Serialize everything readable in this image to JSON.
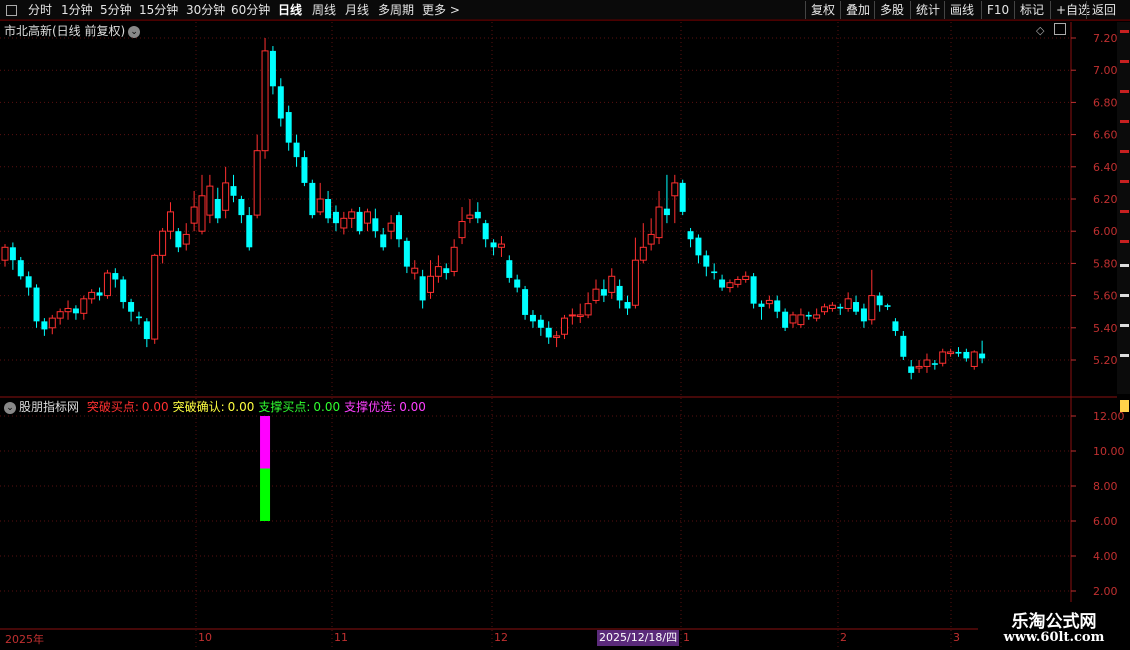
{
  "toolbar": {
    "periods": [
      "分时",
      "1分钟",
      "5分钟",
      "15分钟",
      "30分钟",
      "60分钟",
      "日线",
      "周线",
      "月线",
      "多周期",
      "更多 >"
    ],
    "active_period": "日线",
    "actions": [
      "复权",
      "叠加",
      "多股",
      "统计",
      "画线",
      "F10",
      "标记",
      "+自选",
      "返回"
    ]
  },
  "main_chart": {
    "title": "市北高新(日线 前复权)",
    "price_axis": [
      "7.20",
      "7.00",
      "6.80",
      "6.60",
      "6.40",
      "6.20",
      "6.00",
      "5.80",
      "5.60",
      "5.40",
      "5.20"
    ]
  },
  "indicator": {
    "name": "股朋指标网",
    "fields": [
      {
        "label": "突破买点:",
        "value": "0.00",
        "color": "#ff3030"
      },
      {
        "label": "突破确认:",
        "value": "0.00",
        "color": "#ffff40"
      },
      {
        "label": "支撑买点:",
        "value": "0.00",
        "color": "#30ff30"
      },
      {
        "label": "支撑优选:",
        "value": "0.00",
        "color": "#ff40ff"
      }
    ],
    "axis": [
      "12.00",
      "10.00",
      "8.00",
      "6.00",
      "4.00",
      "2.00"
    ]
  },
  "date_axis": {
    "labels": [
      "2025年",
      "10",
      "11",
      "12",
      "1",
      "2",
      "3"
    ],
    "highlight": "2025/12/18/四"
  },
  "watermark": {
    "title": "乐淘公式网",
    "url": "www.60lt.com"
  },
  "chart_data": {
    "type": "candlestick",
    "title": "市北高新(日线 前复权)",
    "ylim": [
      5.05,
      7.25
    ],
    "up_color": "#ff3030",
    "down_color": "#00ffff",
    "candles": [
      [
        5.82,
        5.9,
        5.78,
        5.92
      ],
      [
        5.9,
        5.82,
        5.76,
        5.93
      ],
      [
        5.82,
        5.72,
        5.7,
        5.84
      ],
      [
        5.72,
        5.65,
        5.6,
        5.75
      ],
      [
        5.65,
        5.44,
        5.4,
        5.67
      ],
      [
        5.44,
        5.39,
        5.35,
        5.46
      ],
      [
        5.4,
        5.46,
        5.36,
        5.48
      ],
      [
        5.46,
        5.5,
        5.42,
        5.52
      ],
      [
        5.5,
        5.52,
        5.45,
        5.57
      ],
      [
        5.52,
        5.49,
        5.45,
        5.54
      ],
      [
        5.49,
        5.58,
        5.45,
        5.6
      ],
      [
        5.58,
        5.62,
        5.55,
        5.64
      ],
      [
        5.62,
        5.6,
        5.57,
        5.65
      ],
      [
        5.6,
        5.74,
        5.58,
        5.76
      ],
      [
        5.74,
        5.7,
        5.65,
        5.77
      ],
      [
        5.7,
        5.56,
        5.52,
        5.72
      ],
      [
        5.56,
        5.5,
        5.44,
        5.58
      ],
      [
        5.47,
        5.46,
        5.42,
        5.5
      ],
      [
        5.44,
        5.33,
        5.28,
        5.46
      ],
      [
        5.33,
        5.85,
        5.3,
        5.86
      ],
      [
        5.85,
        6.0,
        5.8,
        6.02
      ],
      [
        6.0,
        6.12,
        5.95,
        6.18
      ],
      [
        6.0,
        5.9,
        5.87,
        6.02
      ],
      [
        5.92,
        5.98,
        5.88,
        6.05
      ],
      [
        6.05,
        6.15,
        6.0,
        6.25
      ],
      [
        6.0,
        6.22,
        5.98,
        6.35
      ],
      [
        6.1,
        6.28,
        6.05,
        6.35
      ],
      [
        6.2,
        6.08,
        6.05,
        6.27
      ],
      [
        6.13,
        6.3,
        6.08,
        6.4
      ],
      [
        6.28,
        6.22,
        6.18,
        6.35
      ],
      [
        6.2,
        6.1,
        6.05,
        6.22
      ],
      [
        6.1,
        5.9,
        5.88,
        6.15
      ],
      [
        6.1,
        6.5,
        6.08,
        6.6
      ],
      [
        6.5,
        7.12,
        6.45,
        7.2
      ],
      [
        7.12,
        6.9,
        6.85,
        7.15
      ],
      [
        6.9,
        6.7,
        6.65,
        6.95
      ],
      [
        6.74,
        6.55,
        6.5,
        6.78
      ],
      [
        6.55,
        6.46,
        6.4,
        6.6
      ],
      [
        6.46,
        6.3,
        6.28,
        6.5
      ],
      [
        6.3,
        6.1,
        6.08,
        6.32
      ],
      [
        6.12,
        6.2,
        6.1,
        6.3
      ],
      [
        6.2,
        6.08,
        6.05,
        6.25
      ],
      [
        6.12,
        6.05,
        6.0,
        6.16
      ],
      [
        6.02,
        6.08,
        5.98,
        6.12
      ],
      [
        6.08,
        6.12,
        6.02,
        6.14
      ],
      [
        6.12,
        6.0,
        5.98,
        6.15
      ],
      [
        6.05,
        6.12,
        6.0,
        6.14
      ],
      [
        6.08,
        6.0,
        5.96,
        6.14
      ],
      [
        5.98,
        5.9,
        5.88,
        6.02
      ],
      [
        6.0,
        6.05,
        5.95,
        6.1
      ],
      [
        6.1,
        5.95,
        5.9,
        6.12
      ],
      [
        5.94,
        5.78,
        5.74,
        5.96
      ],
      [
        5.74,
        5.77,
        5.7,
        5.82
      ],
      [
        5.72,
        5.57,
        5.52,
        5.76
      ],
      [
        5.62,
        5.72,
        5.58,
        5.82
      ],
      [
        5.72,
        5.78,
        5.68,
        5.85
      ],
      [
        5.77,
        5.74,
        5.7,
        5.8
      ],
      [
        5.75,
        5.9,
        5.72,
        5.95
      ],
      [
        5.96,
        6.06,
        5.92,
        6.15
      ],
      [
        6.08,
        6.1,
        6.05,
        6.2
      ],
      [
        6.12,
        6.08,
        6.05,
        6.18
      ],
      [
        6.05,
        5.95,
        5.9,
        6.07
      ],
      [
        5.93,
        5.9,
        5.85,
        5.95
      ],
      [
        5.9,
        5.92,
        5.84,
        5.97
      ],
      [
        5.82,
        5.71,
        5.68,
        5.85
      ],
      [
        5.7,
        5.65,
        5.62,
        5.73
      ],
      [
        5.64,
        5.48,
        5.45,
        5.66
      ],
      [
        5.48,
        5.44,
        5.4,
        5.51
      ],
      [
        5.45,
        5.4,
        5.35,
        5.48
      ],
      [
        5.4,
        5.34,
        5.3,
        5.44
      ],
      [
        5.34,
        5.35,
        5.28,
        5.38
      ],
      [
        5.36,
        5.46,
        5.33,
        5.48
      ],
      [
        5.48,
        5.48,
        5.42,
        5.52
      ],
      [
        5.47,
        5.48,
        5.43,
        5.55
      ],
      [
        5.48,
        5.55,
        5.46,
        5.62
      ],
      [
        5.57,
        5.64,
        5.55,
        5.7
      ],
      [
        5.64,
        5.6,
        5.56,
        5.7
      ],
      [
        5.62,
        5.72,
        5.58,
        5.77
      ],
      [
        5.66,
        5.57,
        5.52,
        5.7
      ],
      [
        5.56,
        5.52,
        5.48,
        5.6
      ],
      [
        5.54,
        5.82,
        5.52,
        5.96
      ],
      [
        5.82,
        5.9,
        5.8,
        6.05
      ],
      [
        5.92,
        5.98,
        5.88,
        6.08
      ],
      [
        5.96,
        6.15,
        5.92,
        6.25
      ],
      [
        6.14,
        6.1,
        6.05,
        6.35
      ],
      [
        6.22,
        6.3,
        6.05,
        6.35
      ],
      [
        6.3,
        6.12,
        6.1,
        6.32
      ],
      [
        6.0,
        5.95,
        5.9,
        6.02
      ],
      [
        5.96,
        5.85,
        5.8,
        5.98
      ],
      [
        5.85,
        5.78,
        5.72,
        5.88
      ],
      [
        5.75,
        5.74,
        5.7,
        5.8
      ],
      [
        5.7,
        5.65,
        5.63,
        5.73
      ],
      [
        5.65,
        5.68,
        5.62,
        5.7
      ],
      [
        5.67,
        5.7,
        5.65,
        5.72
      ],
      [
        5.7,
        5.72,
        5.68,
        5.75
      ],
      [
        5.72,
        5.55,
        5.52,
        5.74
      ],
      [
        5.55,
        5.53,
        5.45,
        5.57
      ],
      [
        5.55,
        5.57,
        5.52,
        5.6
      ],
      [
        5.57,
        5.5,
        5.46,
        5.6
      ],
      [
        5.5,
        5.4,
        5.38,
        5.52
      ],
      [
        5.43,
        5.48,
        5.4,
        5.5
      ],
      [
        5.42,
        5.48,
        5.4,
        5.52
      ],
      [
        5.48,
        5.47,
        5.45,
        5.5
      ],
      [
        5.46,
        5.48,
        5.44,
        5.52
      ],
      [
        5.5,
        5.53,
        5.48,
        5.55
      ],
      [
        5.52,
        5.54,
        5.5,
        5.56
      ],
      [
        5.53,
        5.52,
        5.48,
        5.55
      ],
      [
        5.52,
        5.58,
        5.5,
        5.62
      ],
      [
        5.56,
        5.5,
        5.48,
        5.6
      ],
      [
        5.52,
        5.44,
        5.4,
        5.55
      ],
      [
        5.45,
        5.6,
        5.42,
        5.76
      ],
      [
        5.6,
        5.54,
        5.5,
        5.62
      ],
      [
        5.54,
        5.53,
        5.51,
        5.55
      ],
      [
        5.44,
        5.38,
        5.35,
        5.46
      ],
      [
        5.35,
        5.22,
        5.2,
        5.38
      ],
      [
        5.16,
        5.12,
        5.08,
        5.2
      ],
      [
        5.15,
        5.16,
        5.12,
        5.2
      ],
      [
        5.16,
        5.2,
        5.12,
        5.24
      ],
      [
        5.18,
        5.17,
        5.14,
        5.2
      ],
      [
        5.18,
        5.25,
        5.16,
        5.27
      ],
      [
        5.24,
        5.25,
        5.22,
        5.27
      ],
      [
        5.25,
        5.24,
        5.22,
        5.28
      ],
      [
        5.25,
        5.21,
        5.19,
        5.27
      ],
      [
        5.16,
        5.25,
        5.14,
        5.26
      ],
      [
        5.24,
        5.21,
        5.18,
        5.32
      ]
    ],
    "indicator_bars": [
      {
        "index": 33,
        "bottom": 6.0,
        "top": 9.0,
        "color": "#00ff00"
      },
      {
        "index": 33,
        "bottom": 9.0,
        "top": 12.0,
        "color": "#ff00ff"
      }
    ],
    "indicator_ylim": [
      1.5,
      12.8
    ]
  }
}
